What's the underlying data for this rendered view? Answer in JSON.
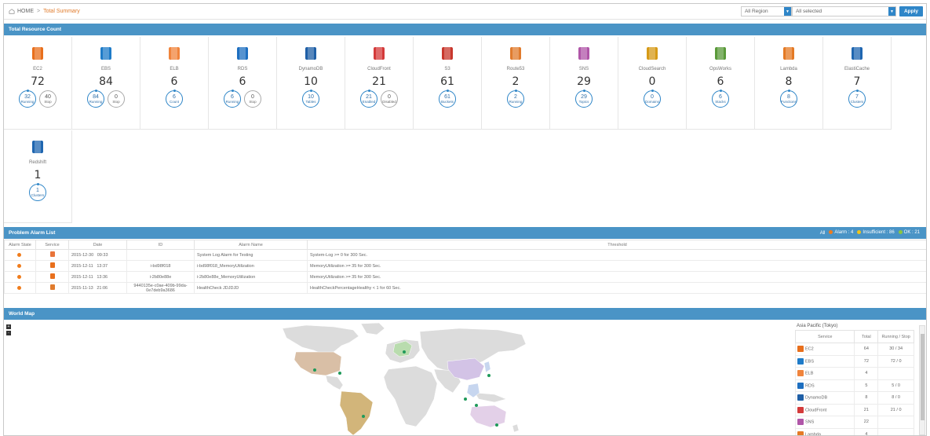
{
  "breadcrumb": {
    "home": "HOME",
    "separator": ">",
    "current": "Total Summary"
  },
  "filters": {
    "region": "All Region",
    "selection": "All selected",
    "apply_label": "Apply"
  },
  "sections": {
    "resources": "Total Resource Count",
    "alarms": "Problem Alarm List",
    "map": "World Map"
  },
  "resources": [
    {
      "name": "EC2",
      "count": "72",
      "color": "#e86f1c",
      "circles": [
        {
          "n": "32",
          "l": "Running",
          "blue": true
        },
        {
          "n": "40",
          "l": "Stop",
          "blue": false
        }
      ]
    },
    {
      "name": "EBS",
      "count": "84",
      "color": "#1e7bc8",
      "circles": [
        {
          "n": "84",
          "l": "Running",
          "blue": true
        },
        {
          "n": "0",
          "l": "Stop",
          "blue": false
        }
      ]
    },
    {
      "name": "ELB",
      "count": "6",
      "color": "#f0843c",
      "circles": [
        {
          "n": "6",
          "l": "Count",
          "blue": true
        }
      ]
    },
    {
      "name": "RDS",
      "count": "6",
      "color": "#1e6fc0",
      "circles": [
        {
          "n": "6",
          "l": "Running",
          "blue": true
        },
        {
          "n": "0",
          "l": "Stop",
          "blue": false
        }
      ]
    },
    {
      "name": "DynamoDB",
      "count": "10",
      "color": "#1f5fa6",
      "circles": [
        {
          "n": "10",
          "l": "Tables",
          "blue": true
        }
      ]
    },
    {
      "name": "CloudFront",
      "count": "21",
      "color": "#d43a3a",
      "circles": [
        {
          "n": "21",
          "l": "Enabled",
          "blue": true
        },
        {
          "n": "0",
          "l": "Disabled",
          "blue": false
        }
      ]
    },
    {
      "name": "S3",
      "count": "61",
      "color": "#c8372d",
      "circles": [
        {
          "n": "61",
          "l": "Buckets",
          "blue": true
        }
      ]
    },
    {
      "name": "Route53",
      "count": "2",
      "color": "#e07b2d",
      "circles": [
        {
          "n": "2",
          "l": "Running",
          "blue": true
        }
      ]
    },
    {
      "name": "SNS",
      "count": "29",
      "color": "#b056a8",
      "circles": [
        {
          "n": "29",
          "l": "Topics",
          "blue": true
        }
      ]
    },
    {
      "name": "CloudSearch",
      "count": "0",
      "color": "#d69a17",
      "circles": [
        {
          "n": "0",
          "l": "Domains",
          "blue": true
        }
      ]
    },
    {
      "name": "OpsWorks",
      "count": "6",
      "color": "#5a9a3a",
      "circles": [
        {
          "n": "6",
          "l": "Stacks",
          "blue": true
        }
      ]
    },
    {
      "name": "Lambda",
      "count": "8",
      "color": "#e47a25",
      "circles": [
        {
          "n": "8",
          "l": "Functions",
          "blue": true
        }
      ]
    },
    {
      "name": "ElastiCache",
      "count": "7",
      "color": "#1f66b0",
      "circles": [
        {
          "n": "7",
          "l": "Clusters",
          "blue": true
        }
      ]
    },
    {
      "name": "Redshift",
      "count": "1",
      "color": "#1f66b0",
      "circles": [
        {
          "n": "1",
          "l": "Clusters",
          "blue": true
        }
      ]
    }
  ],
  "alarm_legend": {
    "all": "All",
    "alarm": "Alarm : 4",
    "insufficient": "Insufficient : 86",
    "ok": "OK : 21",
    "colors": {
      "alarm": "#f07c1c",
      "insufficient": "#f0c419",
      "ok": "#8cc63f"
    }
  },
  "alarm_headers": [
    "Alarm State",
    "Service",
    "Date",
    "ID",
    "Alarm Name",
    "Threshold"
  ],
  "alarms": [
    {
      "date": "2015-12-30",
      "time": "09:33",
      "id": "",
      "name": "System Log Alarm for Testing",
      "threshold": "System-Log >= 0 for 300 Sec.",
      "service_icon": "cloud-icon",
      "svc_color": "#e8743a"
    },
    {
      "date": "2015-12-11",
      "time": "13:37",
      "id": "i-bd98f018",
      "name": "i-bd98f018_MemoryUtilization",
      "threshold": "MemoryUtilization >= 35 for 300 Sec.",
      "service_icon": "ec2-icon",
      "svc_color": "#e86f1c"
    },
    {
      "date": "2015-12-11",
      "time": "13:36",
      "id": "i-2b80e88e",
      "name": "i-2b80e88e_MemoryUtilization",
      "threshold": "MemoryUtilization >= 35 for 300 Sec.",
      "service_icon": "ec2-icon",
      "svc_color": "#e86f1c"
    },
    {
      "date": "2015-11-13",
      "time": "21:06",
      "id": "9440135e-c0ae-409b-99da-0e7deb9a3686",
      "name": "HealthCheck JDJDJD",
      "threshold": "HealthCheckPercentageHealthy < 1 for 60 Sec.",
      "service_icon": "route53-icon",
      "svc_color": "#e07b2d"
    }
  ],
  "region_panel": {
    "title": "Asia Pacific (Tokyo)",
    "headers": [
      "Service",
      "Total",
      "Running / Stop"
    ],
    "rows": [
      {
        "service": "EC2",
        "total": "64",
        "rs": "30 / 34",
        "color": "#e86f1c"
      },
      {
        "service": "EBS",
        "total": "72",
        "rs": "72 / 0",
        "color": "#1e7bc8"
      },
      {
        "service": "ELB",
        "total": "4",
        "rs": "",
        "color": "#f0843c"
      },
      {
        "service": "RDS",
        "total": "5",
        "rs": "5 / 0",
        "color": "#1e6fc0"
      },
      {
        "service": "DynamoDB",
        "total": "8",
        "rs": "8 / 0",
        "color": "#1f5fa6"
      },
      {
        "service": "CloudFront",
        "total": "21",
        "rs": "21 / 0",
        "color": "#d43a3a"
      },
      {
        "service": "SNS",
        "total": "22",
        "rs": "",
        "color": "#b056a8"
      },
      {
        "service": "Lambda",
        "total": "4",
        "rs": "",
        "color": "#e47a25"
      }
    ]
  },
  "map_zoom": {
    "plus": "+",
    "minus": "-"
  }
}
